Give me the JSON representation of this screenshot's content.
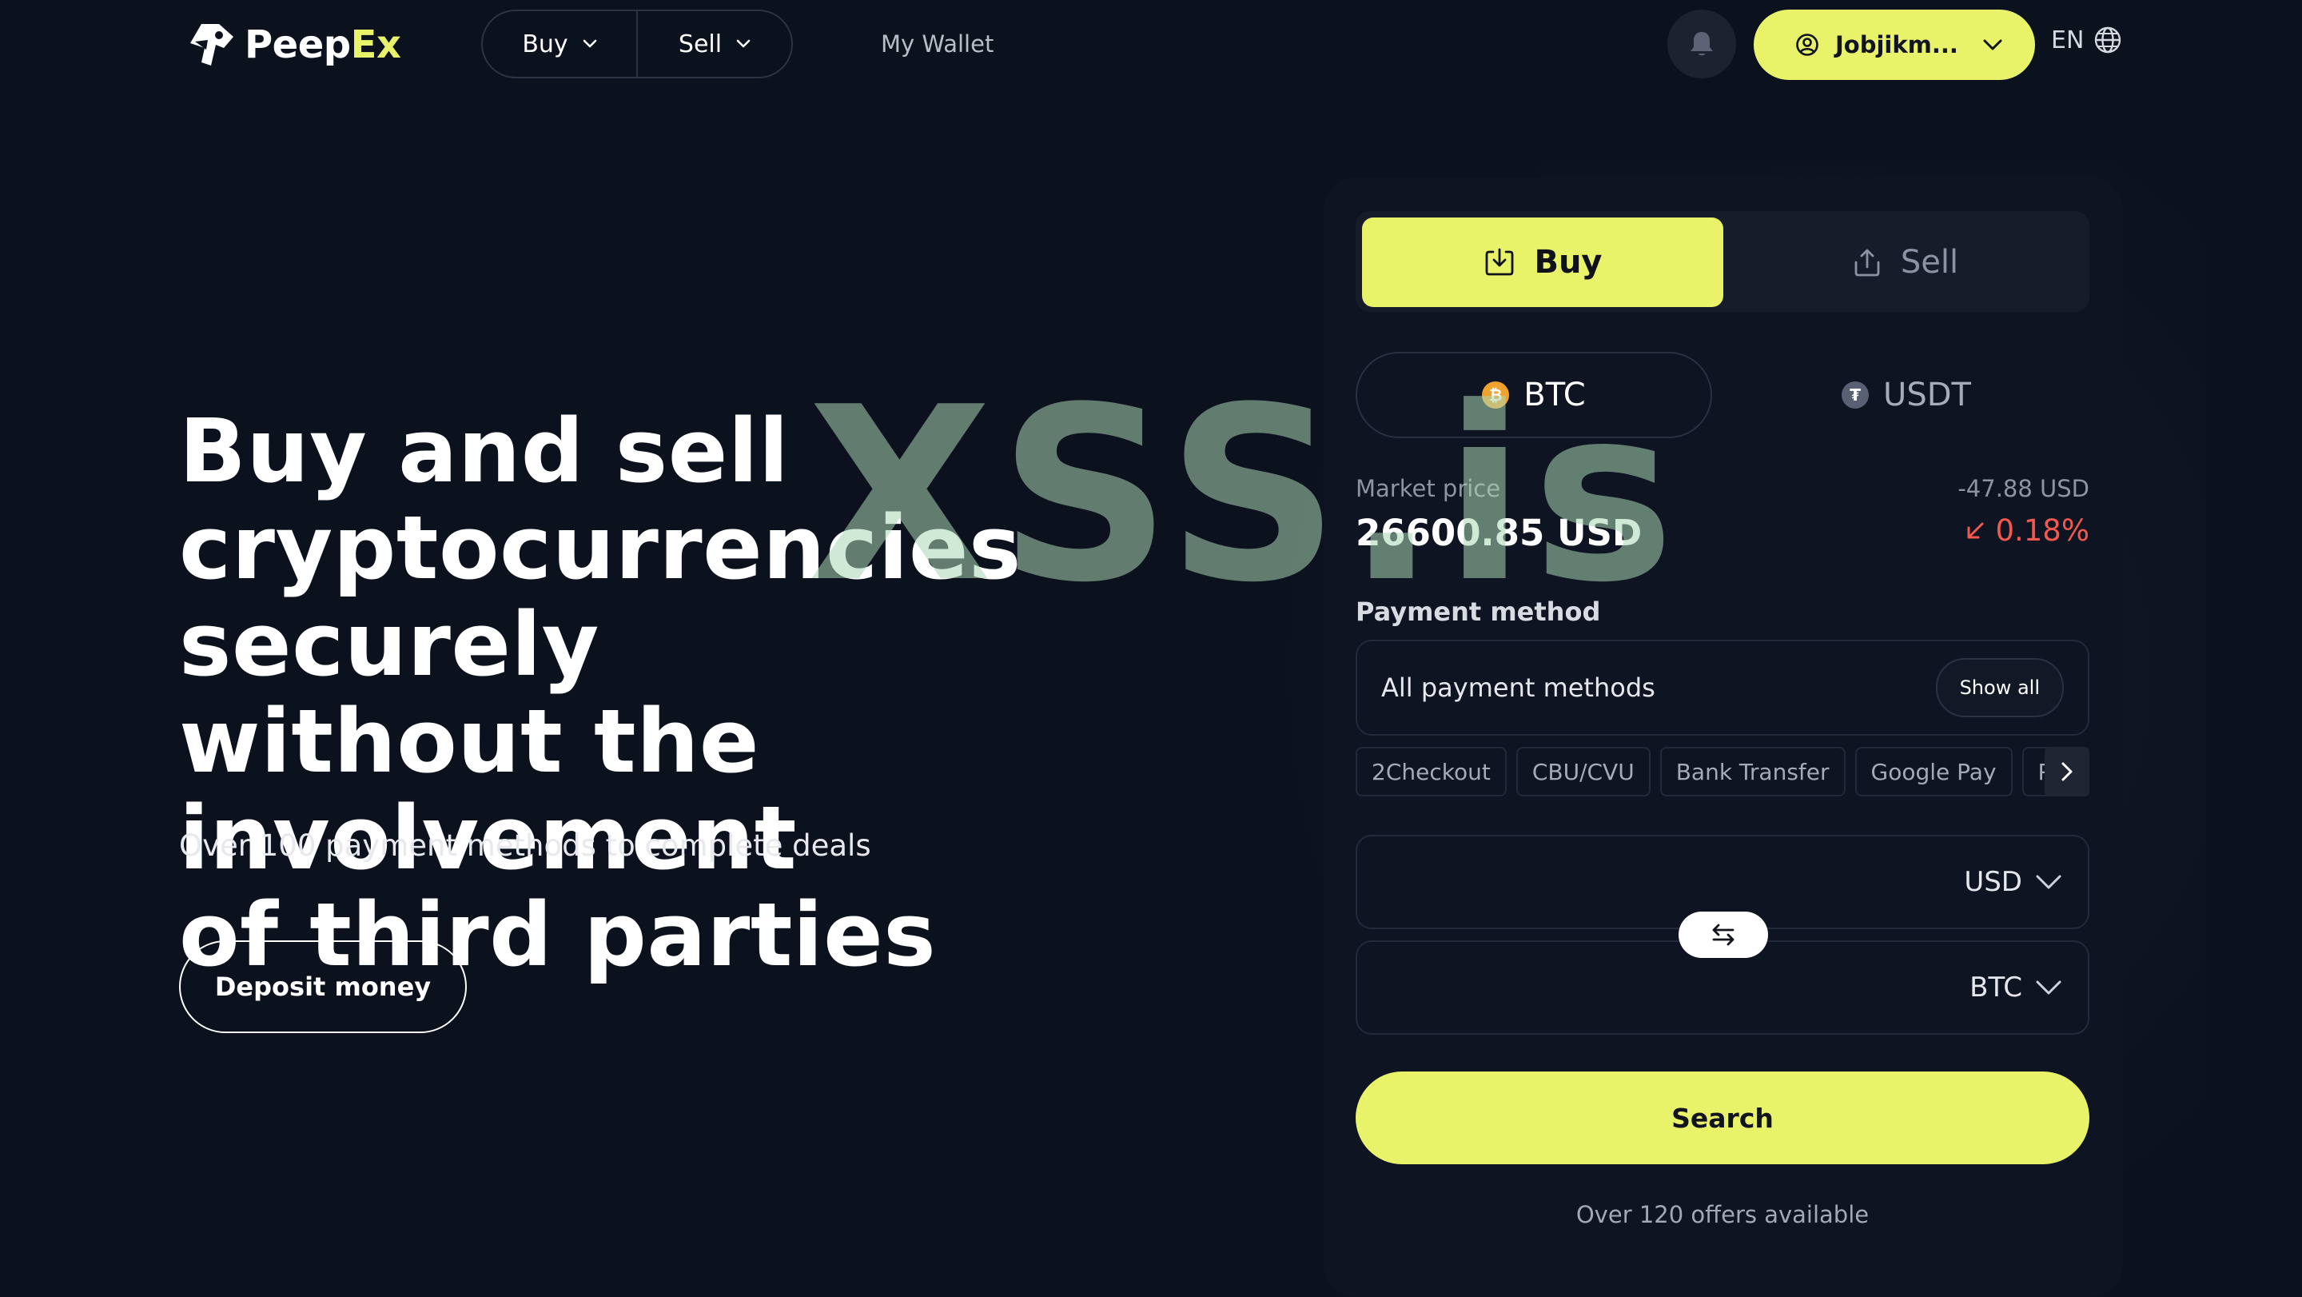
{
  "brand": {
    "name_part1": "Peep",
    "name_part2": "Ex",
    "accent_color": "#e8f36a"
  },
  "nav": {
    "buy_label": "Buy",
    "sell_label": "Sell",
    "wallet_label": "My Wallet"
  },
  "header": {
    "user_name": "Jobjikm...",
    "language": "EN"
  },
  "hero": {
    "title_lines": [
      "Buy and sell",
      "cryptocurrencies securely",
      "without the involvement",
      "of third parties"
    ],
    "subtitle": "Over 100 payment methods to complete deals",
    "deposit_label": "Deposit money"
  },
  "widget": {
    "tabs": {
      "buy": "Buy",
      "sell": "Sell",
      "active": "buy"
    },
    "coins": {
      "btc": "BTC",
      "usdt": "USDT",
      "active": "btc"
    },
    "market": {
      "label": "Market price",
      "value": "26600.85 USD",
      "change": "-47.88 USD",
      "percent": "0.18%",
      "down_color": "#f1584f"
    },
    "payment": {
      "label": "Payment method",
      "selected": "All payment methods",
      "show_all": "Show all",
      "chips": [
        "2Checkout",
        "CBU/CVU",
        "Bank Transfer",
        "Google Pay",
        "Pa"
      ]
    },
    "fiat_currency": "USD",
    "crypto_currency": "BTC",
    "search_label": "Search",
    "offers_text": "Over 120 offers available"
  },
  "watermark": "XSS.is"
}
